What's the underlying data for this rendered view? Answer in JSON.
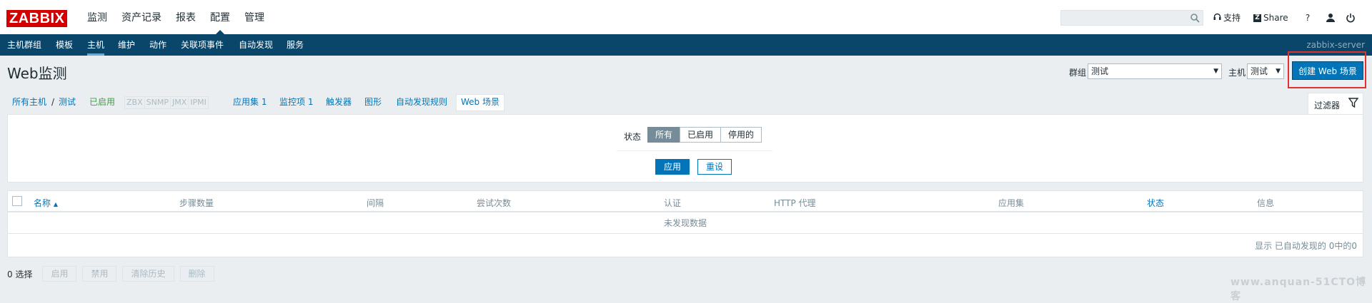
{
  "brand": {
    "logo": "ZABBIX",
    "logo_color": "#d40000"
  },
  "main_menu": [
    "监测",
    "资产记录",
    "报表",
    "配置",
    "管理"
  ],
  "main_menu_active": "配置",
  "top_links": {
    "support": "支持",
    "share": "Share",
    "help": "?"
  },
  "sub_menu": [
    "主机群组",
    "模板",
    "主机",
    "维护",
    "动作",
    "关联项事件",
    "自动发现",
    "服务"
  ],
  "sub_menu_active": "主机",
  "server_name": "zabbix-server",
  "page": {
    "title": "Web监测",
    "group_label": "群组",
    "group_value": "测试",
    "host_label": "主机",
    "host_value": "测试",
    "create_button": "创建 Web 场景"
  },
  "host_nav": {
    "all_hosts": "所有主机",
    "separator": "/",
    "host": "测试",
    "status": "已启用",
    "protocols": [
      "ZBX",
      "SNMP",
      "JMX",
      "IPMI"
    ],
    "applications": "应用集 1",
    "items": "监控项 1",
    "triggers": "触发器",
    "graphs": "图形",
    "discovery": "自动发现规则",
    "web": "Web 场景"
  },
  "filter": {
    "tab_label": "过滤器",
    "status_label": "状态",
    "options": [
      "所有",
      "已启用",
      "停用的"
    ],
    "selected": "所有",
    "apply": "应用",
    "reset": "重设"
  },
  "table": {
    "columns": [
      "名称",
      "步骤数量",
      "间隔",
      "尝试次数",
      "认证",
      "HTTP 代理",
      "应用集",
      "状态",
      "信息"
    ],
    "sort_indicator": "▲",
    "no_data": "未发现数据",
    "footer": "显示 已自动发现的 0中的0"
  },
  "actions": {
    "selected": "0 选择",
    "buttons": [
      "启用",
      "禁用",
      "清除历史",
      "删除"
    ]
  },
  "watermark": "www.anquan-51CTO博客",
  "colors": {
    "nav_bg": "#0a466a",
    "accent": "#0275b8",
    "highlight_box": "#e03131"
  }
}
